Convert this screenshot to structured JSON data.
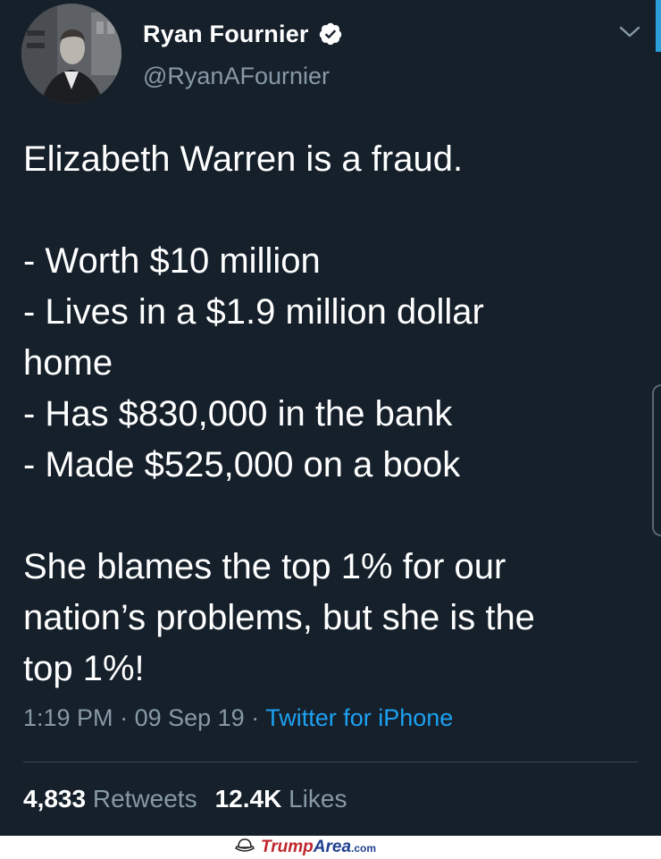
{
  "tweet": {
    "display_name": "Ryan Fournier",
    "handle": "@RyanAFournier",
    "verified": true,
    "text_lines": [
      "Elizabeth Warren is a fraud.",
      "",
      "- Worth $10 million",
      "- Lives in a $1.9 million dollar",
      "home",
      "- Has $830,000 in the bank",
      "- Made $525,000 on a book",
      "",
      "She blames the top 1% for our",
      "nation’s problems, but she is the",
      "top 1%!"
    ],
    "time": "1:19 PM",
    "date": "09 Sep 19",
    "separator": "·",
    "source": "Twitter for iPhone",
    "retweets_count": "4,833",
    "retweets_label": "Retweets",
    "likes_count": "12.4K",
    "likes_label": "Likes"
  },
  "icons": {
    "verified": "verified-badge-icon",
    "menu": "chevron-down-icon"
  },
  "colors": {
    "background": "#15202b",
    "text": "#ffffff",
    "secondary": "#8899a6",
    "link": "#1da1f2"
  },
  "watermark": {
    "part1": "Trump",
    "part2": "Area",
    "suffix": ".com"
  }
}
